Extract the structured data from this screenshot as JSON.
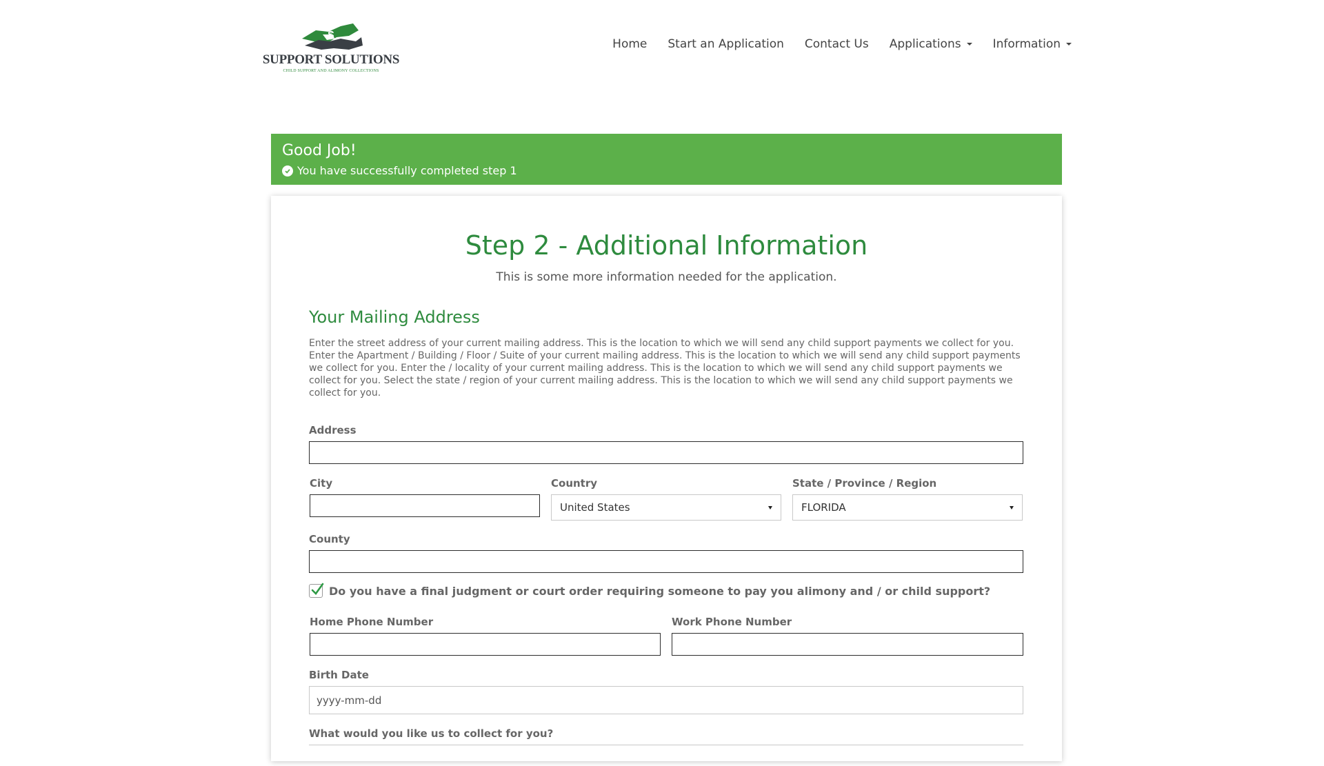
{
  "brand": {
    "name": "SUPPORT SOLUTIONS",
    "tagline": "CHILD SUPPORT AND ALIMONY COLLECTIONS",
    "colors": {
      "green": "#2e8b3e",
      "dark": "#3a3f45"
    }
  },
  "nav": {
    "items": [
      {
        "label": "Home"
      },
      {
        "label": "Start an Application"
      },
      {
        "label": "Contact Us"
      },
      {
        "label": "Applications"
      },
      {
        "label": "Information"
      }
    ]
  },
  "banner": {
    "title": "Good Job!",
    "message": "You have successfully completed step 1",
    "color": "#5cb04a"
  },
  "step": {
    "title": "Step 2 - Additional Information",
    "subtitle": "This is some more information needed for the application."
  },
  "mailing": {
    "title": "Your Mailing Address",
    "description": "Enter the street address of your current mailing address. This is the location to which we will send any child support payments we collect for you. Enter the Apartment / Building / Floor / Suite of your current mailing address. This is the location to which we will send any child support payments we collect for you. Enter the / locality of your current mailing address. This is the location to which we will send any child support payments we collect for you. Select the state / region of your current mailing address. This is the location to which we will send any child support payments we collect for you."
  },
  "form": {
    "address_label": "Address",
    "address_value": "",
    "city_label": "City",
    "city_value": "",
    "country_label": "Country",
    "country_value": "United States",
    "state_label": "State / Province / Region",
    "state_value": "FLORIDA",
    "county_label": "County",
    "county_value": "",
    "judgment_question": "Do you have a final judgment or court order requiring someone to pay you alimony and / or child support?",
    "judgment_checked": true,
    "home_phone_label": "Home Phone Number",
    "work_phone_label": "Work Phone Number",
    "birth_label": "Birth Date",
    "birth_placeholder": "yyyy-mm-dd",
    "collect_label": "What would you like us to collect for you?"
  }
}
